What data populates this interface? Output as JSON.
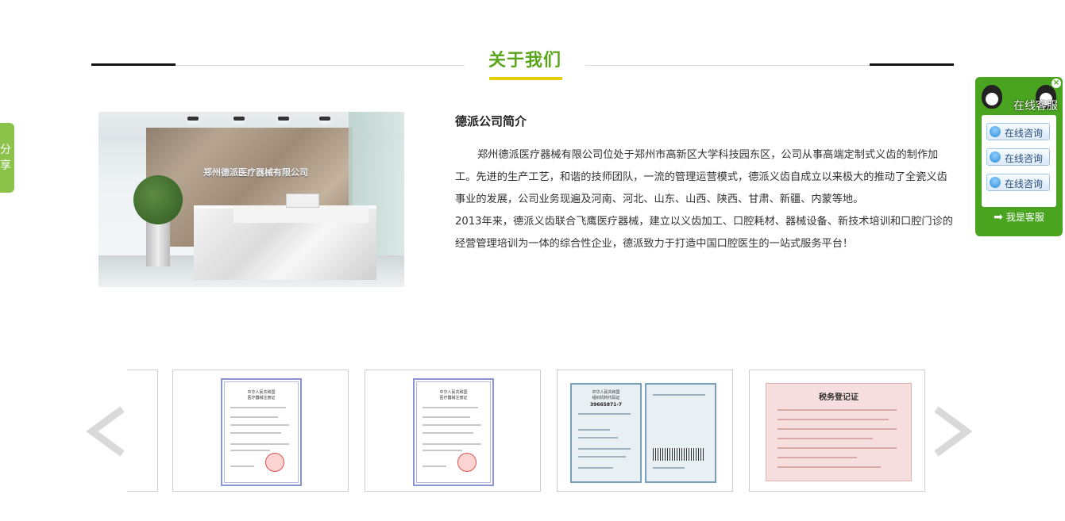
{
  "section": {
    "title": "关于我们"
  },
  "photo": {
    "sign_text": "郑州德派医疗器械有限公司"
  },
  "intro": {
    "heading": "德派公司简介",
    "paragraph1": "郑州德派医疗器械有限公司位处于郑州市高新区大学科技园东区，公司从事高端定制式义齿的制作加工。先进的生产工艺，和谐的技师团队，一流的管理运营模式，德派义齿自成立以来极大的推动了全瓷义齿事业的发展，公司业务现遍及河南、河北、山东、山西、陕西、甘肃、新疆、内蒙等地。",
    "paragraph2": "2013年来，德派义齿联合飞鹰医疗器械，建立以义齿加工、口腔耗材、器械设备、新技术培训和口腔门诊的经营管理培训为一体的综合性企业，德派致力于打造中国口腔医生的一站式服务平台！"
  },
  "share_tab": {
    "line1": "分",
    "line2": "享"
  },
  "service_widget": {
    "title": "在线客服",
    "close_glyph": "×",
    "buttons": [
      "在线咨询",
      "在线咨询",
      "在线咨询"
    ],
    "footer": "我是客服",
    "footer_arrow": "➡"
  },
  "carousel": {
    "prev_icon": "chevron-left-icon",
    "next_icon": "chevron-right-icon",
    "items": [
      {
        "type": "certificate",
        "header": "中华人民共和国\n医疗器械注册证"
      },
      {
        "type": "certificate",
        "header": "中华人民共和国\n医疗器械注册证"
      },
      {
        "type": "org-code",
        "header": "中华人民共和国\n组织机构代码证",
        "number": "39665871-7"
      },
      {
        "type": "tax",
        "header": "税务登记证"
      }
    ]
  },
  "colors": {
    "title_green": "#5aa51a",
    "underline_yellow": "#e6cf00",
    "widget_green": "#4aa420",
    "share_green": "#8bc34a"
  }
}
